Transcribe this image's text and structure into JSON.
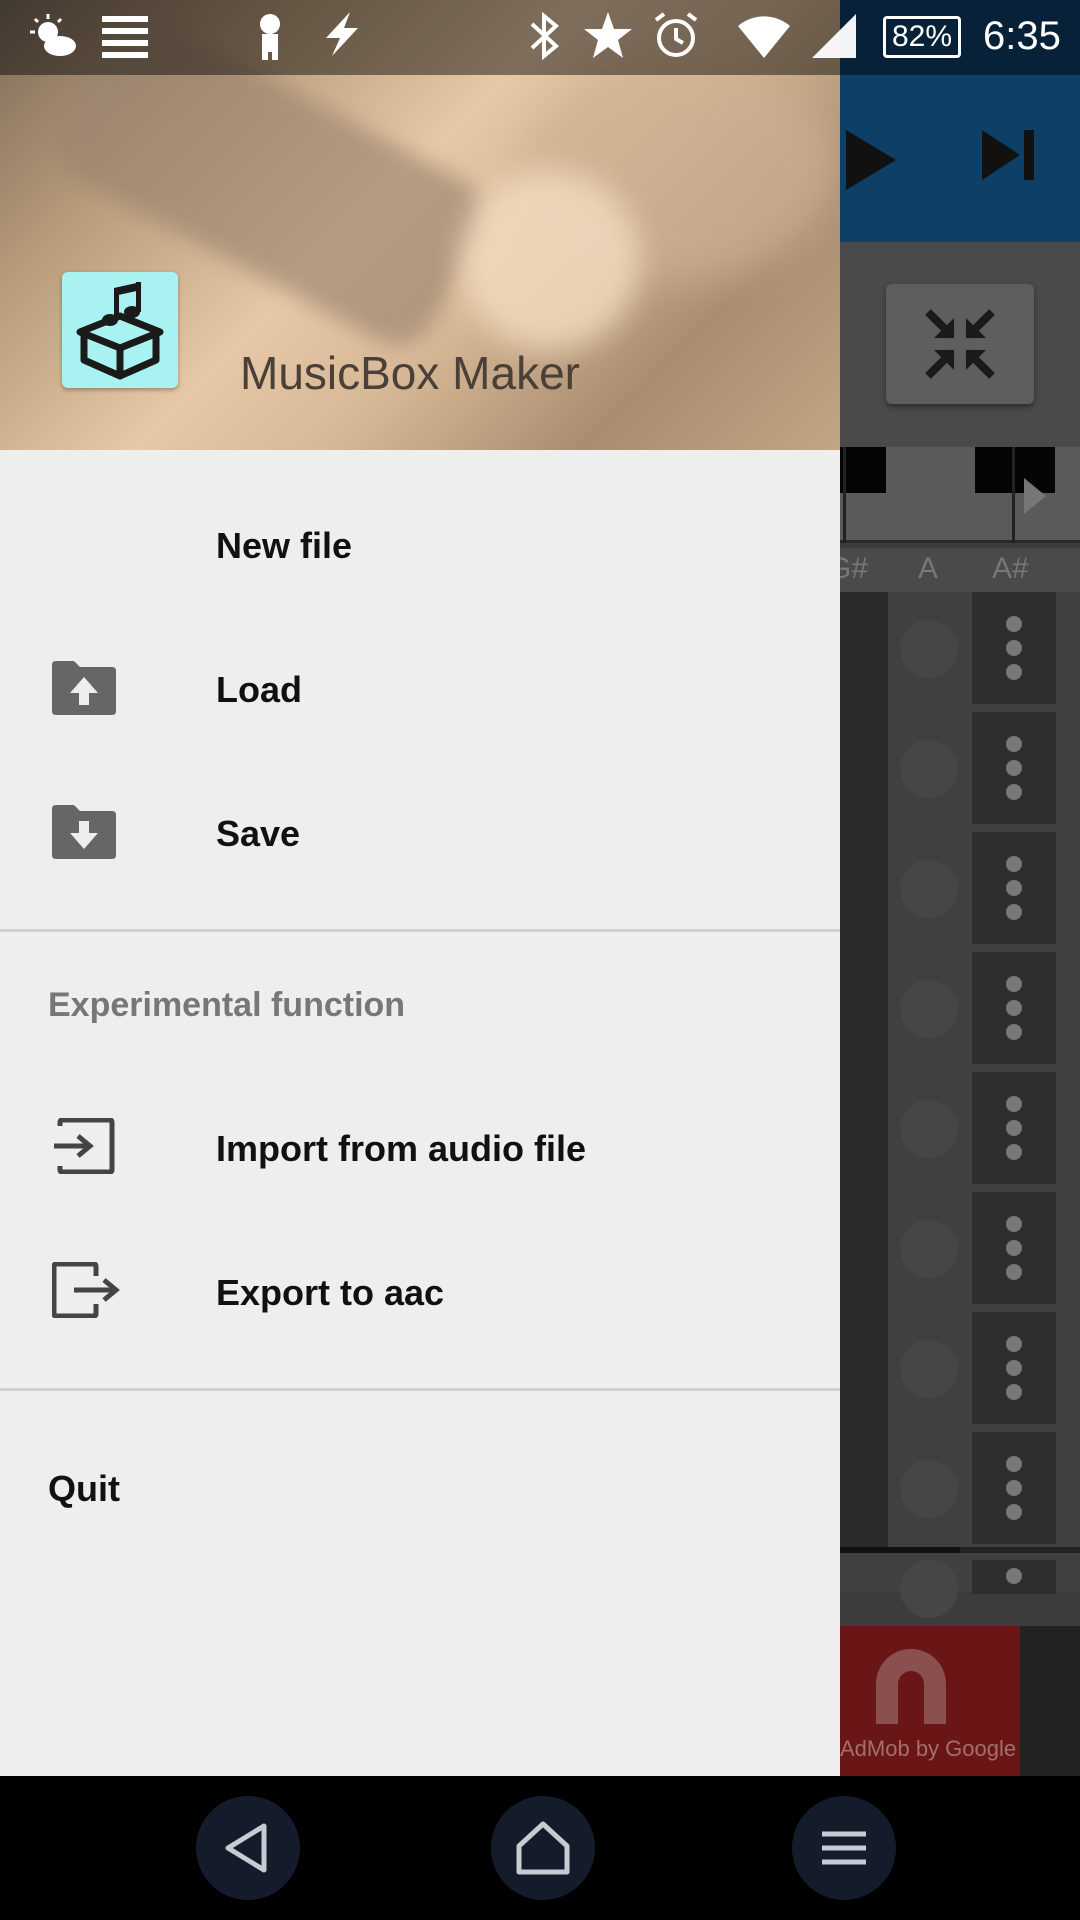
{
  "status_bar": {
    "icons": [
      "weather-icon",
      "notification-list-icon",
      "character-icon",
      "flash-icon",
      "bluetooth-icon",
      "star-icon",
      "alarm-icon",
      "wifi-icon",
      "signal-icon"
    ],
    "battery": "82%",
    "time": "6:35"
  },
  "background_app": {
    "toolbar_icons": [
      "play-icon",
      "skip-next-icon"
    ],
    "note_labels": [
      "G#",
      "A",
      "A#"
    ],
    "ad_text": "AdMob by Google"
  },
  "drawer": {
    "app_name": "MusicBox Maker",
    "logo_icon": "music-box-icon",
    "items": [
      {
        "label": "New file",
        "icon": ""
      },
      {
        "label": "Load",
        "icon": "folder-upload-icon"
      },
      {
        "label": "Save",
        "icon": "folder-download-icon"
      }
    ],
    "section_title": "Experimental function",
    "experimental_items": [
      {
        "label": "Import from audio file",
        "icon": "import-icon"
      },
      {
        "label": "Export to aac",
        "icon": "export-icon"
      }
    ],
    "quit_label": "Quit"
  },
  "nav_bar": {
    "buttons": [
      "back-icon",
      "home-icon",
      "menu-icon"
    ]
  },
  "colors": {
    "drawer_bg": "#eeeeee",
    "toolbar": "#0e3f66",
    "logo_bg": "#a9f2f2",
    "icon_grey": "#666666"
  }
}
